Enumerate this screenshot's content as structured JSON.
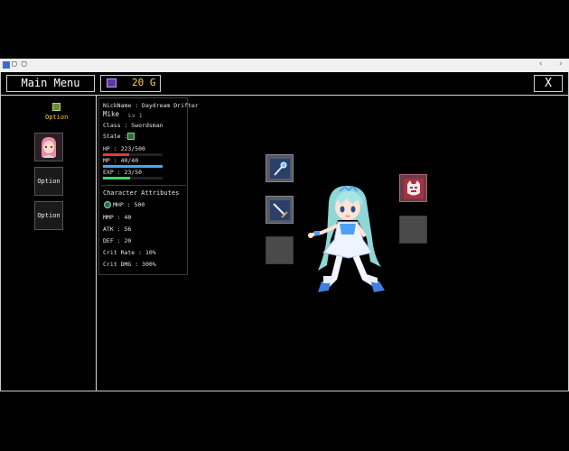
{
  "window": {
    "title": "▢ ▢"
  },
  "header": {
    "main_menu_label": "Main Menu",
    "gold": "20 G",
    "close_label": "X"
  },
  "sidebar": {
    "top_option_label": "Option",
    "buttons": [
      "Option",
      "Option"
    ]
  },
  "character_info": {
    "nickname": "NickName : Daydream Drifter",
    "name": "Mike",
    "level": "Lv 1",
    "class": "Class : Swordsman",
    "state": "State :",
    "hp_text": "HP :  223/500",
    "mp_text": "MP :  40/40",
    "exp_text": "EXP : 23/50",
    "hp_fraction": 0.446,
    "mp_fraction": 1.0,
    "exp_fraction": 0.46
  },
  "attributes": {
    "title": "Character Attributes",
    "rows": [
      "MHP :  500",
      "MMP :   40",
      "ATK :   56",
      "DEF :   20",
      "Crit Rate :  10%",
      "Crit DMG :  300%"
    ]
  },
  "colors": {
    "hp": "#e23b3b",
    "mp": "#4aa3f0",
    "exp": "#3fd36a",
    "gold": "#ffd642"
  },
  "equipment": {
    "slots": [
      "wand-icon",
      "sword-icon",
      "empty",
      "demon-mask-icon",
      "empty"
    ]
  }
}
